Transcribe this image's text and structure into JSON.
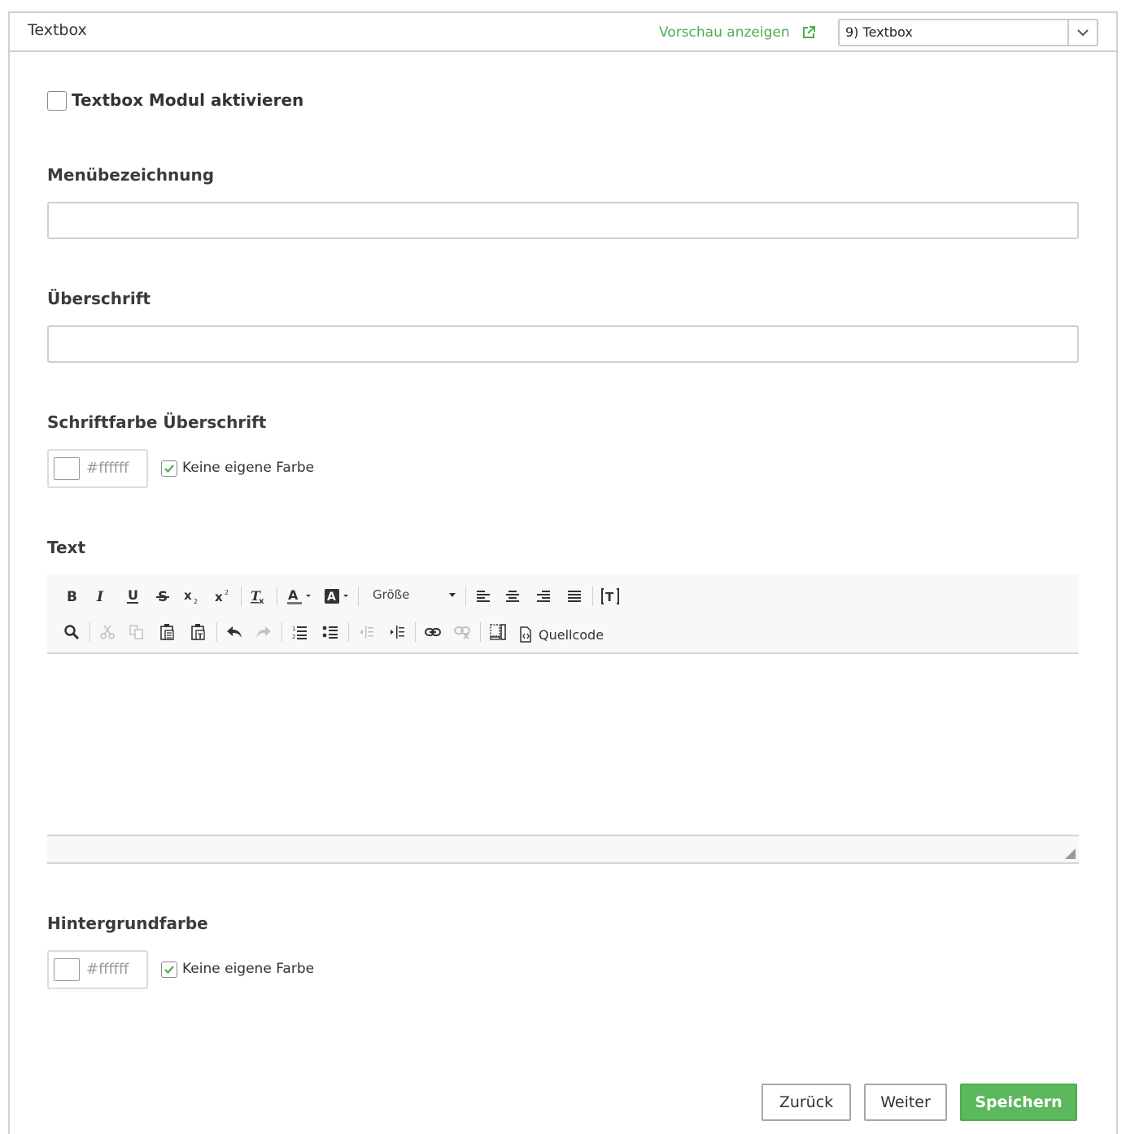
{
  "header": {
    "title": "Textbox",
    "preview_link": "Vorschau anzeigen",
    "module_select_value": "9) Textbox"
  },
  "activate": {
    "label": "Textbox Modul aktivieren",
    "checked": false
  },
  "fields": {
    "menu_label": {
      "label": "Menübezeichnung",
      "value": ""
    },
    "heading": {
      "label": "Überschrift",
      "value": ""
    },
    "heading_color": {
      "label": "Schriftfarbe Überschrift",
      "value": "#ffffff",
      "no_color_label": "Keine eigene Farbe",
      "no_color_checked": true
    },
    "text": {
      "label": "Text",
      "size_combo": "Größe",
      "source_label": "Quellcode"
    },
    "background_color": {
      "label": "Hintergrundfarbe",
      "value": "#ffffff",
      "no_color_label": "Keine eigene Farbe",
      "no_color_checked": true
    }
  },
  "buttons": {
    "back": "Zurück",
    "next": "Weiter",
    "save": "Speichern"
  },
  "colors": {
    "accent_green": "#5cb85c",
    "link_green": "#4cae4c",
    "border": "#d0d0d0"
  }
}
